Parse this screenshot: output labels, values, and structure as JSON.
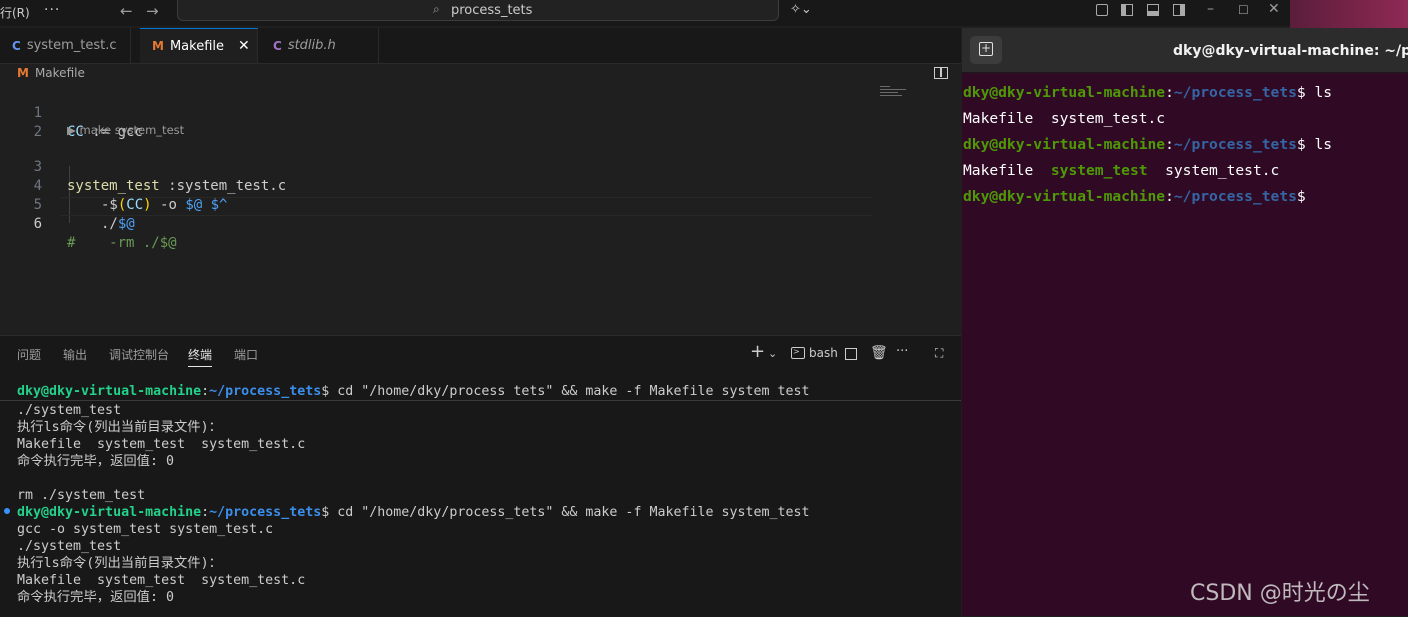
{
  "titlebar": {
    "menu_fragment": "行(R)",
    "more": "···",
    "back": "←",
    "forward": "→",
    "search_text": "process_tets",
    "window_controls": [
      "layout-icon",
      "sidebar-left-icon",
      "panel-icon",
      "sidebar-right-icon",
      "minimize-icon",
      "maximize-icon",
      "close-icon"
    ]
  },
  "tabs": [
    {
      "icon": "C",
      "label": "system_test.c",
      "active": false,
      "italic": false
    },
    {
      "icon": "M",
      "label": "Makefile",
      "active": true,
      "italic": false
    },
    {
      "icon": "C",
      "label": "stdlib.h",
      "active": false,
      "italic": true
    }
  ],
  "breadcrumb": {
    "icon": "M",
    "label": "Makefile"
  },
  "editor": {
    "codelens": "▶ make system_test",
    "lines": [
      {
        "num": "1"
      },
      {
        "num": "2"
      },
      {
        "num": "3"
      },
      {
        "num": "4"
      },
      {
        "num": "5"
      },
      {
        "num": "6"
      }
    ],
    "tokens": {
      "cc_var": "CC",
      "assign": " := gcc",
      "target": "system_test",
      "deps": " :system_test.c",
      "dash_dollar": "-$",
      "open_paren": "(",
      "cc_ref": "CC",
      "close_paren": ")",
      "o_flag": " -o ",
      "auto_at": "$@",
      "space": " ",
      "auto_caret": "$^",
      "run": "./",
      "auto_at2": "$@",
      "comment": "#    -rm ./$@"
    }
  },
  "panel": {
    "tabs": [
      "问题",
      "输出",
      "调试控制台",
      "终端",
      "端口"
    ],
    "active_tab": "终端",
    "shell": "bash",
    "terminal": {
      "prompt_user": "dky@dky-virtual-machine",
      "prompt_colon": ":",
      "prompt_path": "~/process_tets",
      "prompt_dollar": "$",
      "cmd1": " cd \"/home/dky/process tets\" && make -f Makefile system test",
      "out1": [
        "./system_test",
        "执行ls命令(列出当前目录文件)：",
        "Makefile  system_test  system_test.c",
        "命令执行完毕，返回值: 0",
        "",
        "rm ./system_test"
      ],
      "cmd2": " cd \"/home/dky/process_tets\" && make -f Makefile system_test",
      "out2": [
        "gcc -o system_test system_test.c",
        "./system_test",
        "执行ls命令(列出当前目录文件)：",
        "Makefile  system_test  system_test.c",
        "命令执行完毕，返回值: 0"
      ]
    }
  },
  "right_terminal": {
    "title": "dky@dky-virtual-machine: ~/proc",
    "prompt_user": "dky@dky-virtual-machine",
    "prompt_path": "~/process_tets",
    "cmd": " ls",
    "out1": "Makefile  system_test.c",
    "out2_a": "Makefile  ",
    "out2_exe": "system_test",
    "out2_b": "  system_test.c"
  },
  "watermark": "CSDN @时光の尘"
}
